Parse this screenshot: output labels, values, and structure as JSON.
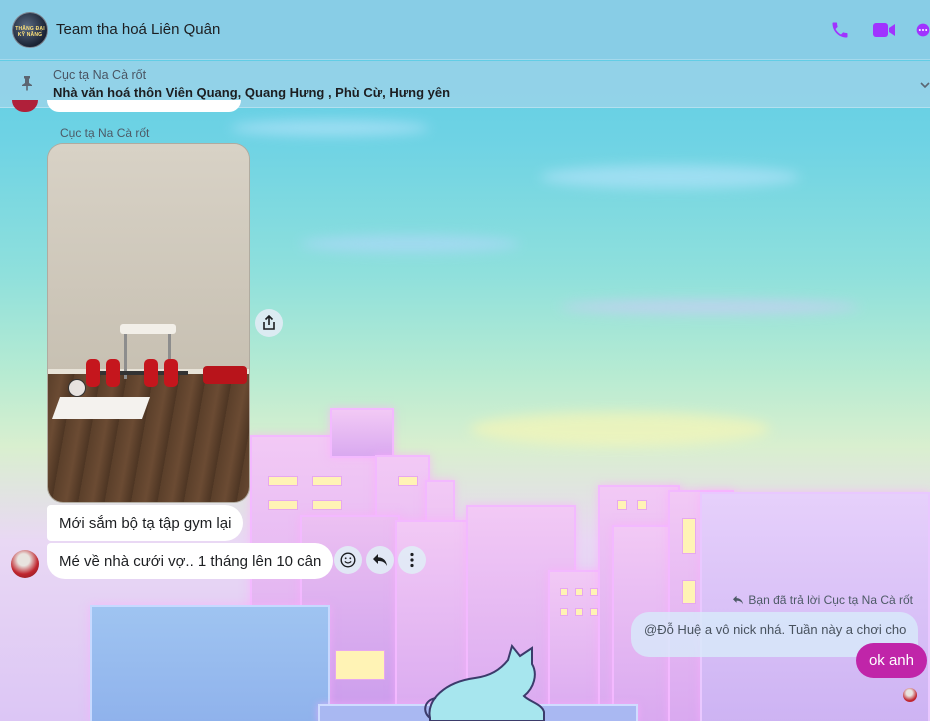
{
  "header": {
    "title": "Team tha hoá Liên Quân",
    "avatar_text": "THĂNG ĐẠI KỸ NĂNG",
    "icons": [
      "phone-icon",
      "video-camera-icon",
      "more-options-icon"
    ],
    "accent_color": "#a033ff"
  },
  "pinned": {
    "sender": "Cục tạ Na Cà rốt",
    "message": "Nhà văn hoá thôn Viên Quang, Quang Hưng , Phù Cừ, Hưng yên"
  },
  "messages": {
    "sender_name": "Cục tạ Na Cà rốt",
    "photo_alt": "",
    "message_1": "Mới sắm bộ tạ tập gym lại",
    "message_2": "Mé về nhà cưới vợ.. 1 tháng lên 10 cân"
  },
  "reply": {
    "note": "Bạn đã trả lời Cục tạ Na Cà rốt",
    "quoted": "@Đỗ Huệ  a vô nick nhá. Tuần này a chơi cho",
    "my_message": "ok anh",
    "my_bubble_color": "#c025a9"
  }
}
